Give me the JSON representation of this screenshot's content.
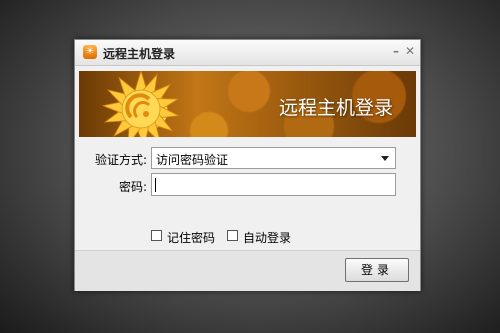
{
  "window": {
    "title": "远程主机登录",
    "icon": "app-logo-icon",
    "minimize_icon": "minimize-icon",
    "close_icon": "close-icon"
  },
  "banner": {
    "title": "远程主机登录",
    "logo": "sunflower-logo"
  },
  "form": {
    "auth_method_label": "验证方式:",
    "auth_method_value": "访问密码验证",
    "password_label": "密码:",
    "password_value": ""
  },
  "options": {
    "remember_password_label": "记住密码",
    "remember_password_checked": false,
    "auto_login_label": "自动登录",
    "auto_login_checked": false
  },
  "footer": {
    "login_button_label": "登录"
  },
  "colors": {
    "accent": "#e07a10",
    "background": "#f0f0f0"
  }
}
